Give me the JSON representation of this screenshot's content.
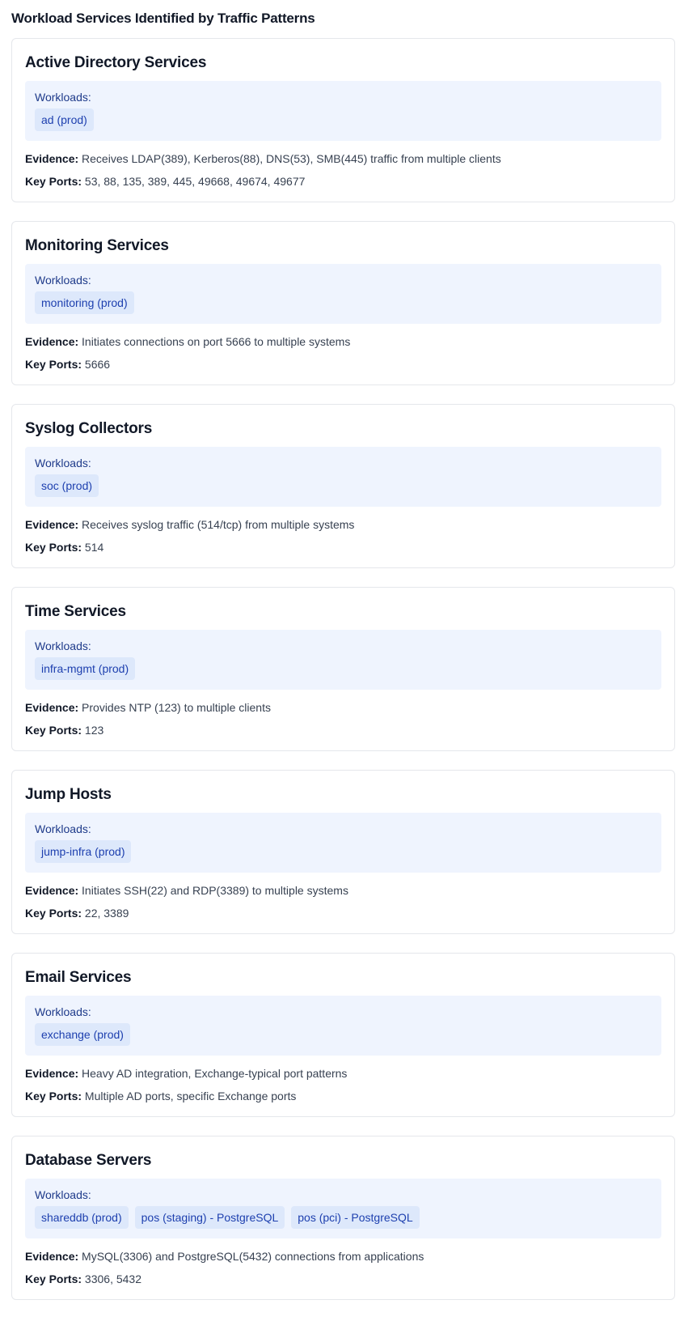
{
  "page_title": "Workload Services Identified by Traffic Patterns",
  "labels": {
    "workloads": "Workloads:",
    "evidence": "Evidence:",
    "key_ports": "Key Ports:"
  },
  "colors": {
    "card_border": "#e5e7eb",
    "workloads_bg": "#eff4fe",
    "chip_bg": "#dde8fb",
    "chip_text": "#1e40af"
  },
  "services": [
    {
      "title": "Active Directory Services",
      "workloads": [
        "ad (prod)"
      ],
      "evidence": "Receives LDAP(389), Kerberos(88), DNS(53), SMB(445) traffic from multiple clients",
      "key_ports": "53, 88, 135, 389, 445, 49668, 49674, 49677"
    },
    {
      "title": "Monitoring Services",
      "workloads": [
        "monitoring (prod)"
      ],
      "evidence": "Initiates connections on port 5666 to multiple systems",
      "key_ports": "5666"
    },
    {
      "title": "Syslog Collectors",
      "workloads": [
        "soc (prod)"
      ],
      "evidence": "Receives syslog traffic (514/tcp) from multiple systems",
      "key_ports": "514"
    },
    {
      "title": "Time Services",
      "workloads": [
        "infra-mgmt (prod)"
      ],
      "evidence": "Provides NTP (123) to multiple clients",
      "key_ports": "123"
    },
    {
      "title": "Jump Hosts",
      "workloads": [
        "jump-infra (prod)"
      ],
      "evidence": "Initiates SSH(22) and RDP(3389) to multiple systems",
      "key_ports": "22, 3389"
    },
    {
      "title": "Email Services",
      "workloads": [
        "exchange (prod)"
      ],
      "evidence": "Heavy AD integration, Exchange-typical port patterns",
      "key_ports": "Multiple AD ports, specific Exchange ports"
    },
    {
      "title": "Database Servers",
      "workloads": [
        "shareddb (prod)",
        "pos (staging) - PostgreSQL",
        "pos (pci) - PostgreSQL"
      ],
      "evidence": "MySQL(3306) and PostgreSQL(5432) connections from applications",
      "key_ports": "3306, 5432"
    }
  ]
}
